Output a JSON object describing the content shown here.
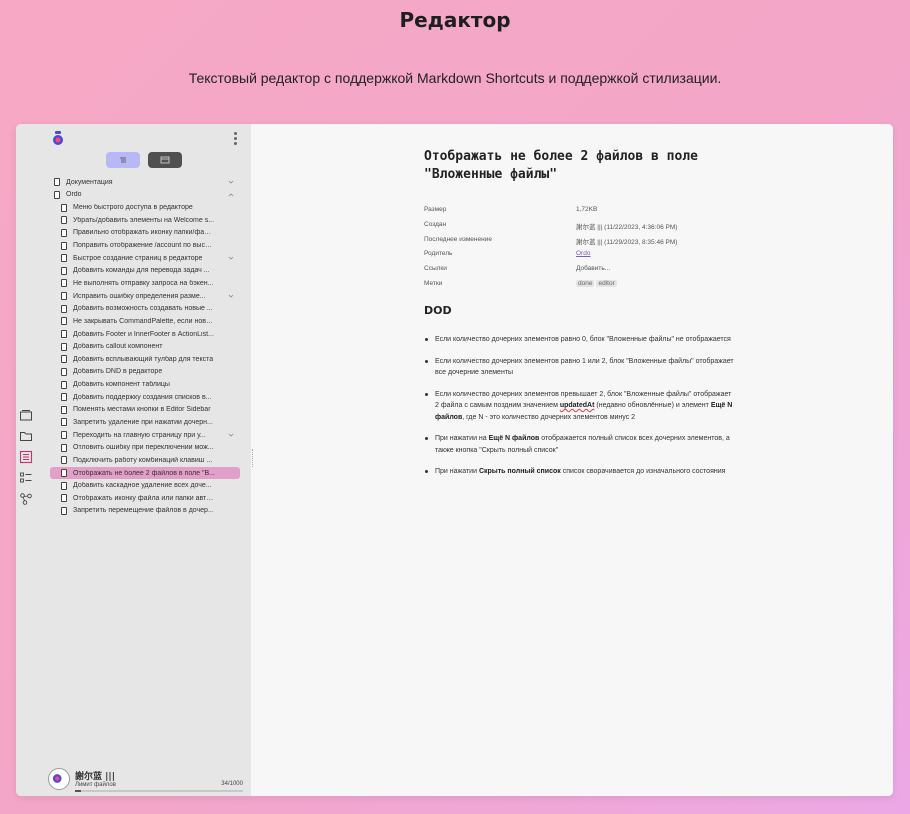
{
  "page": {
    "title": "Редактор",
    "subtitle": "Текстовый редактор с поддержкой Markdown Shortcuts и поддержкой стилизации."
  },
  "sidebar": {
    "tree": [
      {
        "label": "Документация",
        "level": 0,
        "chevron": "down"
      },
      {
        "label": "Ordo",
        "level": 0,
        "chevron": "up"
      },
      {
        "label": "Меню быстрого доступа в редакторе",
        "level": 1
      },
      {
        "label": "Убрать/добавить элементы на Welcome s...",
        "level": 1
      },
      {
        "label": "Правильно отображать иконку папки/файла",
        "level": 1
      },
      {
        "label": "Поправить отображение /account по высоте",
        "level": 1
      },
      {
        "label": "Быстрое создание страниц в редакторе",
        "level": 1,
        "chevron": "down"
      },
      {
        "label": "Добавить команды для перевода задач ...",
        "level": 1
      },
      {
        "label": "Не выполнять отправку запроса на бэкен...",
        "level": 1
      },
      {
        "label": "Исправить ошибку определения разме...",
        "level": 1,
        "chevron": "down"
      },
      {
        "label": "Добавить возможность создавать новые ...",
        "level": 1
      },
      {
        "label": "Не закрывать CommandPalette, если новы...",
        "level": 1
      },
      {
        "label": "Добавить Footer и InnerFooter в ActionList...",
        "level": 1
      },
      {
        "label": "Добавить callout компонент",
        "level": 1
      },
      {
        "label": "Добавить всплывающий тулбар для текста",
        "level": 1
      },
      {
        "label": "Добавить DND в редакторе",
        "level": 1
      },
      {
        "label": "Добавить компонент таблицы",
        "level": 1
      },
      {
        "label": "Добавить поддержку создания списков в...",
        "level": 1
      },
      {
        "label": "Поменять местами кнопки в Editor Sidebar",
        "level": 1
      },
      {
        "label": "Запретить удаление при нажатии дочерн...",
        "level": 1
      },
      {
        "label": "Переходить на главную страницу при у...",
        "level": 1,
        "chevron": "down"
      },
      {
        "label": "Отловить ошибку при переключении мож...",
        "level": 1
      },
      {
        "label": "Подключить работу комбинаций клавиш ...",
        "level": 1
      },
      {
        "label": "Отображать не более 2 файлов в поле \"В...",
        "level": 1,
        "active": true
      },
      {
        "label": "Добавить каскадное удаление всех доче...",
        "level": 1
      },
      {
        "label": "Отображать иконку файла или папки авто...",
        "level": 1
      },
      {
        "label": "Запретить перемещение файлов в дочер...",
        "level": 1
      }
    ],
    "side_icons": [
      "projects-icon",
      "folder-icon",
      "editor-icon",
      "checklist-icon",
      "graph-icon"
    ],
    "user": {
      "name": "謝尔蓝 |||",
      "caption": "Лимит файлов",
      "count": "34/1000",
      "progress": 0.034
    }
  },
  "document": {
    "title": "Отображать не более 2 файлов в поле \"Вложенные файлы\"",
    "props": [
      {
        "key": "Размер",
        "value": "1,72KB"
      },
      {
        "key": "Создан",
        "value": "謝尔蓝 ||| (11/22/2023, 4:36:06 PM)"
      },
      {
        "key": "Последнее изменение",
        "value": "謝尔蓝 ||| (11/29/2023, 8:35:46 PM)"
      },
      {
        "key": "Родитель",
        "value": "Ordo"
      },
      {
        "key": "Ссылки",
        "value": "Добавить..."
      },
      {
        "key": "Метки",
        "tags": [
          "done",
          "editor"
        ]
      }
    ],
    "heading": "DOD",
    "bullets": {
      "b1": "Если количество дочерних элементов равно 0, блок \"Вложенные файлы\" не отображается",
      "b2": "Если количество дочерних элементов равно 1 или 2, блок \"Вложенные файлы\" отображает все дочерние элементы",
      "b3_a": "Если количество дочерних элементов превышает 2, блок \"Вложенные файлы\" отображает 2 файла с самым поздним значением ",
      "b3_b": "updatedAt",
      "b3_c": " (недавно обновлённые) и элемент ",
      "b3_d": "Ещё N файлов",
      "b3_e": ", где N - это количество дочерних элементов минус 2",
      "b4_a": "При нажатии на ",
      "b4_b": "Ещё N файлов",
      "b4_c": " отображается полный список всех дочерних элементов, а также кнопка \"Скрыть полный список\"",
      "b5_a": "При нажатии ",
      "b5_b": "Скрыть полный список",
      "b5_c": " список сворачивается до изначального состояния"
    }
  },
  "colors": {
    "accent": "#b8b8f8",
    "active_row": "#e2a0c8",
    "link": "#7b5cc4"
  }
}
